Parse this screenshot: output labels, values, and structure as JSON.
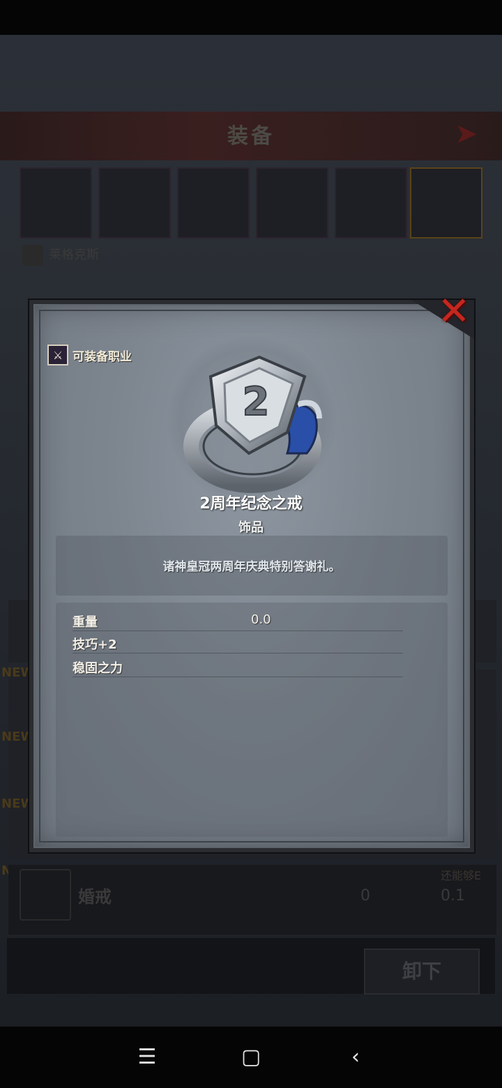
{
  "background": {
    "title": "装备",
    "hero_name": "莱格克斯",
    "new_tag": "NEW",
    "ring_row": {
      "name": "婚戒",
      "value1": "0",
      "value2": "0.1",
      "tag": "还能够E"
    },
    "unequip_label": "卸下"
  },
  "modal": {
    "job_label": "可装备职业",
    "item_name": "2周年纪念之戒",
    "item_type": "饰品",
    "description": "诸神皇冠两周年庆典特别答谢礼。",
    "stats": [
      {
        "label": "重量",
        "value": "0.0"
      },
      {
        "label": "技巧+2",
        "value": ""
      },
      {
        "label": "稳固之力",
        "value": ""
      }
    ],
    "ring_number": "2"
  },
  "colors": {
    "close": "#c5271f",
    "modal_bg": "#7d858f",
    "ring_gem": "#2a4fa8"
  },
  "nav": {
    "menu_icon": "menu-icon",
    "home_icon": "home-icon",
    "back_icon": "back-icon"
  }
}
